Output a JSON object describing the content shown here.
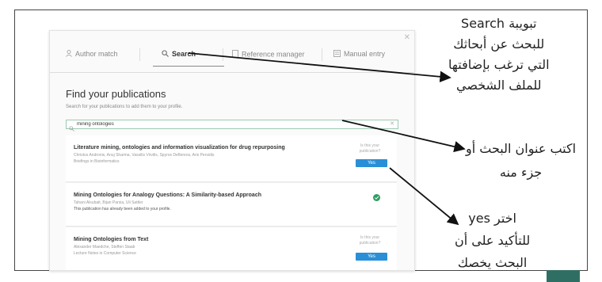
{
  "dialog": {
    "tabs": [
      {
        "label": "Author match",
        "icon": "person-icon"
      },
      {
        "label": "Search",
        "icon": "search-icon",
        "active": true
      },
      {
        "label": "Reference manager",
        "icon": "document-icon"
      },
      {
        "label": "Manual entry",
        "icon": "form-icon"
      }
    ],
    "find_title": "Find your publications",
    "find_subtitle": "Search for your publications to add them to your profile.",
    "search_value": "mining ontologies",
    "results": [
      {
        "title": "Literature mining, ontologies and information visualization for drug repurposing",
        "authors": "Christos Andronis, Anuj Sharma, Vassilis Virvilis, Spyros Deftereos, Aris Persidis",
        "source": "Briefings in Bioinformatics",
        "question": "Is this your publication?",
        "action": "Yes"
      },
      {
        "title": "Mining Ontologies for Analogy Questions: A Similarity-based Approach",
        "authors": "Tahani Alsubait, Bijan Parsia, Uli Sattler",
        "note": "This publication has already been added to your profile.",
        "status": "added"
      },
      {
        "title": "Mining Ontologies from Text",
        "authors": "Alexander Maedche, Steffen Staab",
        "source": "Lecture Notes in Computer Science",
        "question": "Is this your publication?",
        "action": "Yes"
      }
    ]
  },
  "annotations": [
    {
      "lines": [
        "تبويبة Search",
        "للبحث عن أبحاثك",
        "التي ترغب بإضافتها",
        "للملف الشخصي"
      ]
    },
    {
      "lines": [
        "اكتب عنوان البحث أو",
        "جزء منه"
      ]
    },
    {
      "lines": [
        "اختر yes",
        "للتأكيد على أن",
        "البحث يخصك"
      ]
    }
  ],
  "colors": {
    "accent": "#2a8fd6",
    "search_border": "#9cc9b3",
    "check": "#2e9e63",
    "emblem": "#2f6f63"
  }
}
